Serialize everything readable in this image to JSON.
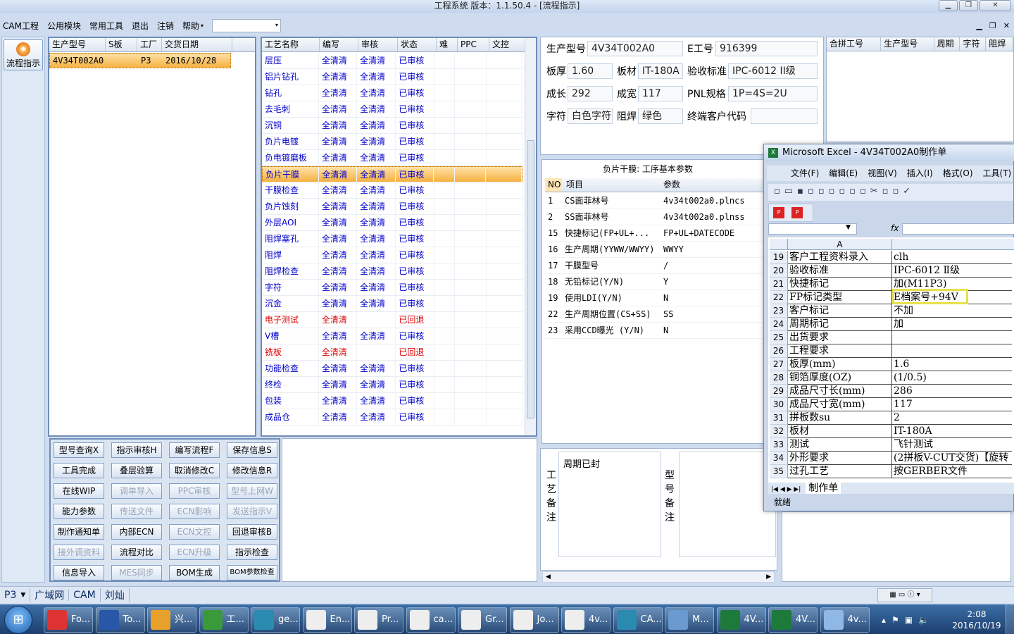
{
  "window": {
    "title": "工程系统  版本：1.1.50.4 - [流程指示]"
  },
  "menu": [
    "CAM工程",
    "公用模块",
    "常用工具",
    "退出",
    "注销",
    "帮助"
  ],
  "left_button": "流程指示",
  "orders": {
    "headers": [
      "生产型号",
      "S板",
      "工厂",
      "交货日期"
    ],
    "rows": [
      [
        "4V34T002A0",
        "",
        "P3",
        "2016/10/28"
      ]
    ]
  },
  "process": {
    "headers": [
      "工艺名称",
      "编写",
      "审核",
      "状态",
      "难",
      "PPC",
      "文控"
    ],
    "rows": [
      {
        "name": "层压",
        "w": "全清清",
        "r": "全清清",
        "s": "已审核",
        "red": false
      },
      {
        "name": "铝片钻孔",
        "w": "全清清",
        "r": "全清清",
        "s": "已审核",
        "red": false
      },
      {
        "name": "钻孔",
        "w": "全清清",
        "r": "全清清",
        "s": "已审核",
        "red": false
      },
      {
        "name": "去毛刺",
        "w": "全清清",
        "r": "全清清",
        "s": "已审核",
        "red": false
      },
      {
        "name": "沉铜",
        "w": "全清清",
        "r": "全清清",
        "s": "已审核",
        "red": false
      },
      {
        "name": "负片电镀",
        "w": "全清清",
        "r": "全清清",
        "s": "已审核",
        "red": false
      },
      {
        "name": "负电镀磨板",
        "w": "全清清",
        "r": "全清清",
        "s": "已审核",
        "red": false
      },
      {
        "name": "负片干膜",
        "w": "全清清",
        "r": "全清清",
        "s": "已审核",
        "red": false,
        "sel": true
      },
      {
        "name": "干膜检查",
        "w": "全清清",
        "r": "全清清",
        "s": "已审核",
        "red": false
      },
      {
        "name": "负片蚀刻",
        "w": "全清清",
        "r": "全清清",
        "s": "已审核",
        "red": false
      },
      {
        "name": "外层AOI",
        "w": "全清清",
        "r": "全清清",
        "s": "已审核",
        "red": false
      },
      {
        "name": "阻焊塞孔",
        "w": "全清清",
        "r": "全清清",
        "s": "已审核",
        "red": false
      },
      {
        "name": "阻焊",
        "w": "全清清",
        "r": "全清清",
        "s": "已审核",
        "red": false
      },
      {
        "name": "阻焊检查",
        "w": "全清清",
        "r": "全清清",
        "s": "已审核",
        "red": false
      },
      {
        "name": "字符",
        "w": "全清清",
        "r": "全清清",
        "s": "已审核",
        "red": false
      },
      {
        "name": "沉金",
        "w": "全清清",
        "r": "全清清",
        "s": "已审核",
        "red": false
      },
      {
        "name": "电子测试",
        "w": "全清清",
        "r": "",
        "s": "已回退",
        "red": true
      },
      {
        "name": "V槽",
        "w": "全清清",
        "r": "全清清",
        "s": "已审核",
        "red": false
      },
      {
        "name": "铣板",
        "w": "全清清",
        "r": "",
        "s": "已回退",
        "red": true
      },
      {
        "name": "功能检查",
        "w": "全清清",
        "r": "全清清",
        "s": "已审核",
        "red": false
      },
      {
        "name": "终检",
        "w": "全清清",
        "r": "全清清",
        "s": "已审核",
        "red": false
      },
      {
        "name": "包装",
        "w": "全清清",
        "r": "全清清",
        "s": "已审核",
        "red": false
      },
      {
        "name": "成品仓",
        "w": "全清清",
        "r": "全清清",
        "s": "已审核",
        "red": false
      }
    ]
  },
  "buttons": [
    [
      "型号查询X",
      "指示审核H",
      "编写流程F",
      "保存信息S"
    ],
    [
      "工具完成",
      "叠层验算",
      "取消修改C",
      "修改信息R"
    ],
    [
      "在线WIP",
      "调单导入",
      "PPC审核",
      "型号上网W"
    ],
    [
      "能力参数",
      "传送文件",
      "ECN影响",
      "发送指示V"
    ],
    [
      "制作通知单",
      "内部ECN",
      "ECN文控",
      "回退审核B"
    ],
    [
      "接外调资料",
      "流程对比",
      "ECN升级",
      "指示检查"
    ],
    [
      "信息导入",
      "MES同步",
      "BOM生成",
      "BOM参数检查"
    ]
  ],
  "disabled_buttons": [
    "调单导入",
    "PPC审核",
    "型号上网W",
    "传送文件",
    "ECN影响",
    "发送指示V",
    "ECN文控",
    "接外调资料",
    "ECN升级",
    "MES同步"
  ],
  "info": {
    "model_label": "生产型号",
    "model": "4V34T002A0",
    "e_label": "E工号",
    "e_no": "916399",
    "thick_label": "板厚",
    "thick": "1.60",
    "mat_label": "板材",
    "mat": "IT-180A",
    "std_label": "验收标准",
    "std": "IPC-6012 II级",
    "len_label": "成长",
    "len": "292",
    "wid_label": "成宽",
    "wid": "117",
    "pnl_label": "PNL规格",
    "pnl": "1P=4S=2U",
    "char_label": "字符",
    "char": "白色字符",
    "mask_label": "阻焊",
    "mask": "绿色",
    "cust_label": "终端客户代码",
    "cust": ""
  },
  "merge": {
    "headers": [
      "合拼工号",
      "生产型号",
      "周期",
      "字符",
      "阻焊"
    ]
  },
  "params": {
    "title": "负片干膜: 工序基本参数",
    "headers": [
      "NO",
      "项目",
      "参数"
    ],
    "rows": [
      [
        "1",
        "CS面菲林号",
        "4v34t002a0.plncs"
      ],
      [
        "2",
        "SS面菲林号",
        "4v34t002a0.plnss"
      ],
      [
        "15",
        "快捷标记(FP+UL+...",
        "FP+UL+DATECODE"
      ],
      [
        "16",
        "生产周期(YYWW/WWYY)",
        "WWYY"
      ],
      [
        "17",
        "干膜型号",
        "/"
      ],
      [
        "18",
        "无铅标记(Y/N)",
        "Y"
      ],
      [
        "19",
        "使用LDI(Y/N)",
        "N"
      ],
      [
        "22",
        "生产周期位置(CS+SS)",
        "SS"
      ],
      [
        "23",
        "采用CCD曝光 (Y/N)",
        "N"
      ]
    ]
  },
  "memo": {
    "process_label": "工艺备注",
    "process_text": "周期已封",
    "model_label": "型号备注"
  },
  "excel": {
    "title": "Microsoft Excel - 4V34T002A0制作单",
    "menu": [
      "文件(F)",
      "编辑(E)",
      "视图(V)",
      "插入(I)",
      "格式(O)",
      "工具(T)"
    ],
    "col": "A",
    "fx": "fx",
    "rows": [
      [
        "19",
        "客户工程资料录入",
        "clh"
      ],
      [
        "20",
        "验收标准",
        "IPC-6012 Ⅱ级"
      ],
      [
        "21",
        "快捷标记",
        "加(M11P3)"
      ],
      [
        "22",
        "FP标记类型",
        "E档案号+94V"
      ],
      [
        "23",
        "客户标记",
        "不加"
      ],
      [
        "24",
        "周期标记",
        "加"
      ],
      [
        "25",
        "出货要求",
        ""
      ],
      [
        "26",
        "工程要求",
        ""
      ],
      [
        "27",
        "板厚(mm)",
        "1.6"
      ],
      [
        "28",
        "铜箔厚度(OZ)",
        " (1/0.5)"
      ],
      [
        "29",
        "成品尺寸长(mm)",
        "286"
      ],
      [
        "30",
        "成品尺寸宽(mm)",
        "117"
      ],
      [
        "31",
        "拼板数su",
        "2"
      ],
      [
        "32",
        "板材",
        "IT-180A"
      ],
      [
        "33",
        "测试",
        "飞针测试"
      ],
      [
        "34",
        "外形要求",
        "(2拼板V-CUT交货)【旋转"
      ],
      [
        "35",
        "过孔工艺",
        "按GERBER文件"
      ]
    ],
    "sheet_tab": "制作单",
    "status": "就绪"
  },
  "statusbar": {
    "p3": "P3",
    "tabs": [
      "广域网",
      "CAM",
      "刘灿"
    ]
  },
  "taskbar": {
    "items": [
      "Fo...",
      "To...",
      "兴...",
      "工...",
      "ge...",
      "En...",
      "Pr...",
      "ca...",
      "Gr...",
      "Jo...",
      "4v...",
      "CA...",
      "M...",
      "4V...",
      "4V...",
      "4v..."
    ],
    "time": "2:08",
    "date": "2016/10/19"
  },
  "colors": {
    "accent": "#f5b041",
    "link": "#0000cc",
    "return": "#e00000"
  }
}
